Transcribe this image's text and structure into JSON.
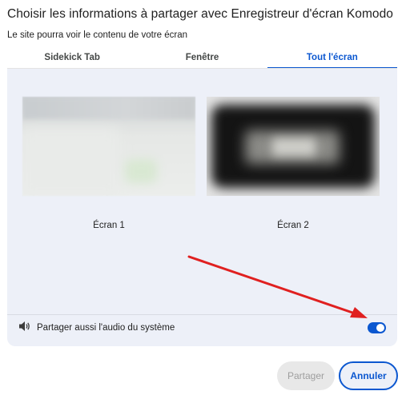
{
  "dialog": {
    "title": "Choisir les informations à partager avec Enregistreur d'écran Komodo",
    "subtitle": "Le site pourra voir le contenu de votre écran"
  },
  "tabs": [
    {
      "label": "Sidekick Tab",
      "active": false
    },
    {
      "label": "Fenêtre",
      "active": false
    },
    {
      "label": "Tout l'écran",
      "active": true
    }
  ],
  "screens": [
    {
      "label": "Écran 1"
    },
    {
      "label": "Écran 2"
    }
  ],
  "audio": {
    "label": "Partager aussi l'audio du système",
    "icon": "speaker-icon",
    "enabled": true
  },
  "buttons": {
    "share_label": "Partager",
    "cancel_label": "Annuler"
  },
  "colors": {
    "accent": "#0b57d0",
    "panel": "#edf0f8",
    "annotation_arrow": "#e02020"
  }
}
